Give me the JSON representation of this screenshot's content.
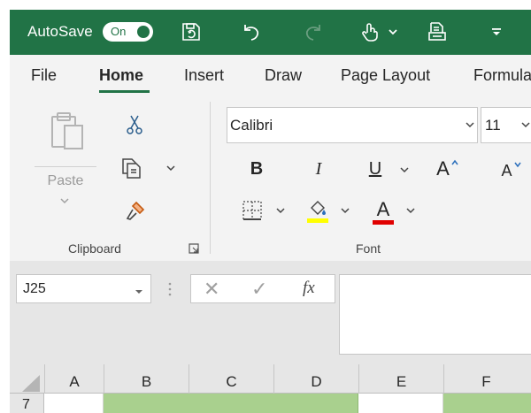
{
  "titlebar": {
    "autosave_label": "AutoSave",
    "toggle_state": "On",
    "icons": [
      "save-icon",
      "undo-icon",
      "redo-icon",
      "touch-mode-icon",
      "chevron-down-icon",
      "print-preview-icon",
      "customize-qat-icon"
    ]
  },
  "tabs": [
    "File",
    "Home",
    "Insert",
    "Draw",
    "Page Layout",
    "Formula"
  ],
  "active_tab": "Home",
  "clipboard": {
    "paste_label": "Paste",
    "group_label": "Clipboard",
    "icons": [
      "paste-icon",
      "cut-icon",
      "copy-icon",
      "format-painter-icon",
      "dialog-launcher-icon"
    ]
  },
  "font": {
    "group_label": "Font",
    "font_name": "Calibri",
    "font_size": "11",
    "bold_label": "B",
    "italic_label": "I",
    "underline_label": "U",
    "grow_label": "A",
    "shrink_label": "A",
    "color_label": "A",
    "highlight_color": "#ffff00",
    "font_color": "#e00000",
    "icons": [
      "borders-icon",
      "fill-color-icon",
      "font-color-icon"
    ]
  },
  "formula_bar": {
    "name_box": "J25",
    "cancel_symbol": "✕",
    "enter_symbol": "✓",
    "fx_label": "fx",
    "formula_value": ""
  },
  "grid": {
    "columns": [
      "A",
      "B",
      "C",
      "D",
      "E",
      "F"
    ],
    "row_number": "7",
    "highlight_fill": "#a9d08e"
  },
  "colors": {
    "title_bar": "#217346",
    "ribbon_bg": "#f3f3f3"
  }
}
